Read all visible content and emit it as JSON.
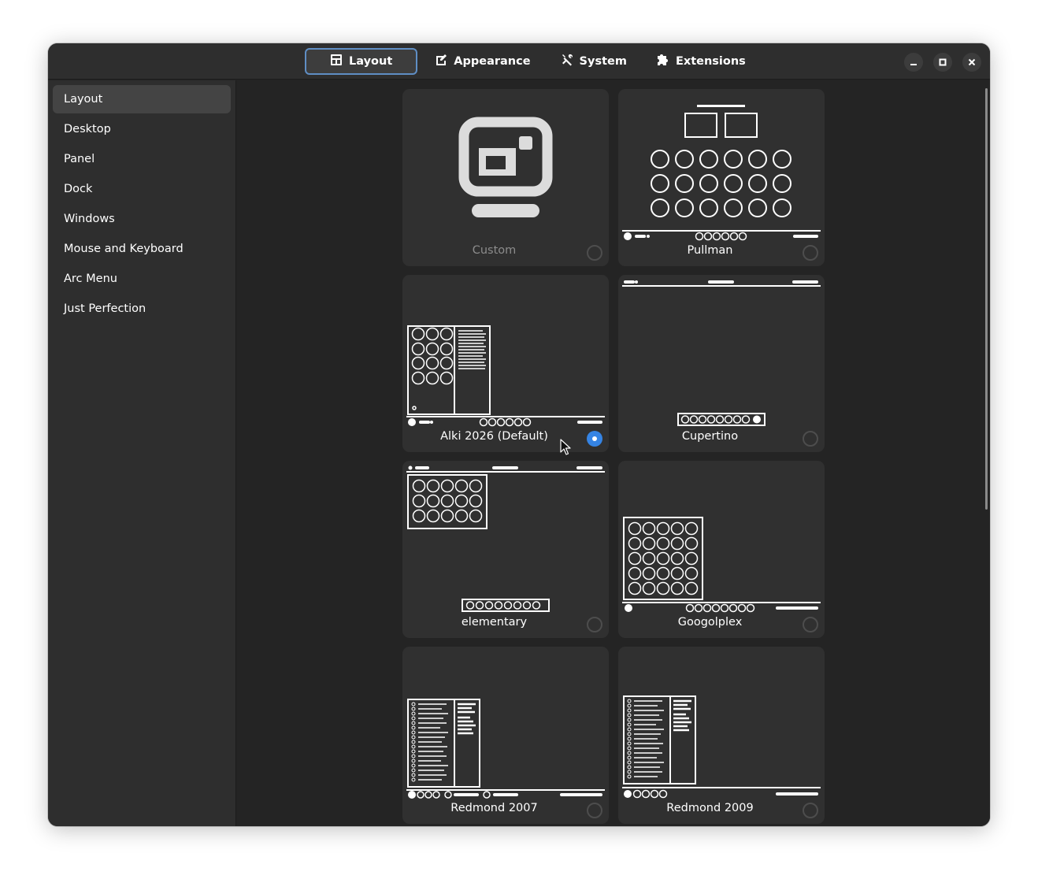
{
  "header": {
    "tabs": [
      {
        "label": "Layout",
        "icon": "layout-icon",
        "active": true
      },
      {
        "label": "Appearance",
        "icon": "appearance-icon",
        "active": false
      },
      {
        "label": "System",
        "icon": "tools-icon",
        "active": false
      },
      {
        "label": "Extensions",
        "icon": "puzzle-icon",
        "active": false
      }
    ],
    "window_controls": [
      "minimize-icon",
      "maximize-icon",
      "close-icon"
    ]
  },
  "sidebar": {
    "items": [
      {
        "label": "Layout",
        "active": true
      },
      {
        "label": "Desktop"
      },
      {
        "label": "Panel"
      },
      {
        "label": "Dock"
      },
      {
        "label": "Windows"
      },
      {
        "label": "Mouse and Keyboard"
      },
      {
        "label": "Arc Menu"
      },
      {
        "label": "Just Perfection"
      }
    ]
  },
  "layouts": [
    {
      "name": "Custom",
      "selected": false,
      "disabled": true
    },
    {
      "name": "Pullman",
      "selected": false
    },
    {
      "name": "Alki 2026 (Default)",
      "selected": true
    },
    {
      "name": "Cupertino",
      "selected": false
    },
    {
      "name": "elementary",
      "selected": false
    },
    {
      "name": "Googolplex",
      "selected": false
    },
    {
      "name": "Redmond 2007",
      "selected": false
    },
    {
      "name": "Redmond 2009",
      "selected": false
    }
  ],
  "colors": {
    "window_bg": "#242424",
    "sidebar_bg": "#2e2e2e",
    "card_bg": "#303030",
    "accent": "#3584e4",
    "active_tab_border": "#5f8ec4"
  }
}
